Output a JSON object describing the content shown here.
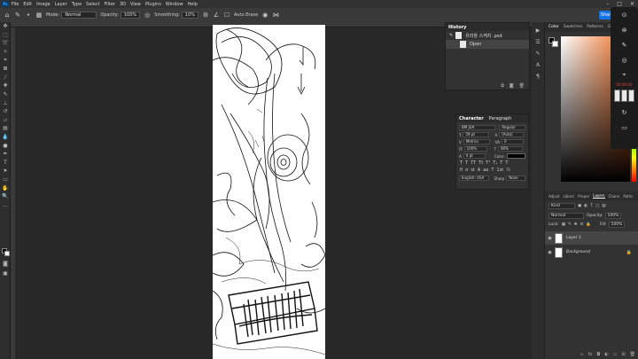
{
  "app": {
    "logo": "Ps"
  },
  "menu": [
    "File",
    "Edit",
    "Image",
    "Layer",
    "Type",
    "Select",
    "Filter",
    "3D",
    "View",
    "Plugins",
    "Window",
    "Help"
  ],
  "options": {
    "mode_label": "Mode:",
    "mode_value": "Normal",
    "opacity_label": "Opacity:",
    "opacity_value": "100%",
    "smoothing_label": "Smoothing:",
    "smoothing_value": "10%",
    "auto_erase_label": "Auto Erase",
    "share_label": "Share"
  },
  "history": {
    "tab": "History",
    "file_name": "유리창 스케치 .psd",
    "state": "Open"
  },
  "character": {
    "tabs": [
      "Character",
      "Paragraph"
    ],
    "font_family": "BM JUA",
    "font_style": "Regular",
    "font_size": "59 pt",
    "leading": "(Auto)",
    "kerning": "Metrics",
    "tracking": "0",
    "vertical_scale": "100%",
    "horizontal_scale": "80%",
    "baseline": "0 pt",
    "color_label": "Color:",
    "language": "English: USA",
    "antialias": "Sharp",
    "antialias_alt": "None"
  },
  "color_panel": {
    "tabs": [
      "Color",
      "Swatches",
      "Patterns",
      "Gradi"
    ],
    "hue_color": "#f26b1d"
  },
  "layers_panel": {
    "tabs": [
      "Adjust",
      "Librari",
      "Proper",
      "Layers",
      "Chann",
      "Paths"
    ],
    "kind": "Kind",
    "blend": "Normal",
    "opacity_label": "Opacity:",
    "opacity": "100%",
    "lock_label": "Lock:",
    "fill_label": "Fill:",
    "fill": "100%",
    "layers": [
      {
        "name": "Layer 1",
        "selected": true
      },
      {
        "name": "Background",
        "selected": false
      }
    ]
  },
  "widget": {
    "timer": "00:00:00"
  }
}
